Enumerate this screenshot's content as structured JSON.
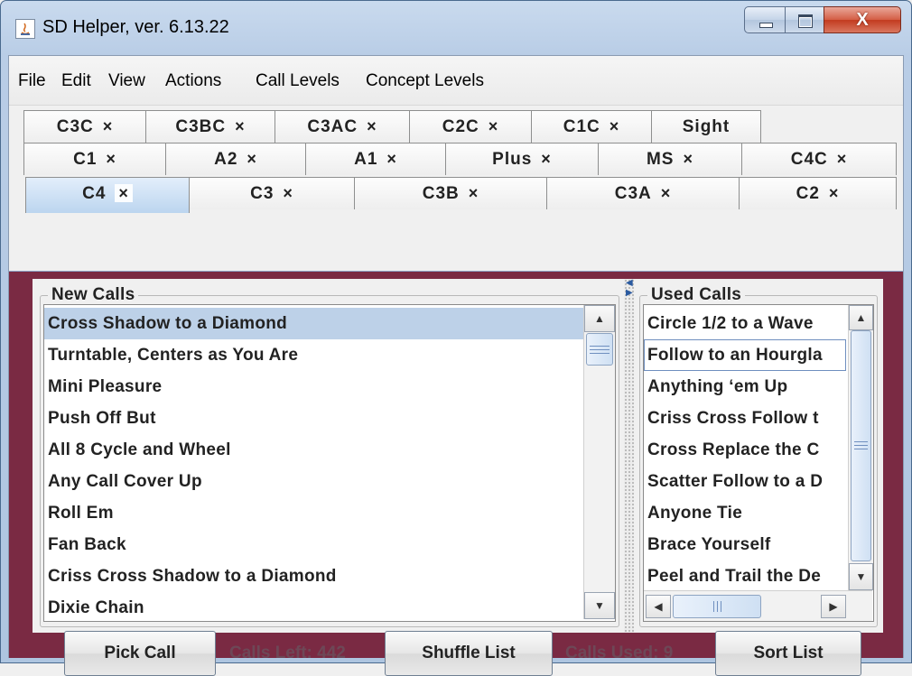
{
  "window": {
    "title": "SD Helper, ver. 6.13.22",
    "close_glyph": "X"
  },
  "menu": [
    "File",
    "Edit",
    "View",
    "Actions",
    "Call Levels",
    "Concept Levels"
  ],
  "tabs": {
    "row1": [
      {
        "label": "C3C",
        "close": "×"
      },
      {
        "label": "C3BC",
        "close": "×"
      },
      {
        "label": "C3AC",
        "close": "×"
      },
      {
        "label": "C2C",
        "close": "×"
      },
      {
        "label": "C1C",
        "close": "×"
      },
      {
        "label": "Sight",
        "close": ""
      }
    ],
    "row2": [
      {
        "label": "C1",
        "close": "×"
      },
      {
        "label": "A2",
        "close": "×"
      },
      {
        "label": "A1",
        "close": "×"
      },
      {
        "label": "Plus",
        "close": "×"
      },
      {
        "label": "MS",
        "close": "×"
      },
      {
        "label": "C4C",
        "close": "×"
      }
    ],
    "row3": [
      {
        "label": "C4",
        "close": "×"
      },
      {
        "label": "C3",
        "close": "×"
      },
      {
        "label": "C3B",
        "close": "×"
      },
      {
        "label": "C3A",
        "close": "×"
      },
      {
        "label": "C2",
        "close": "×"
      }
    ],
    "selected": "C4"
  },
  "new_calls": {
    "title": "New Calls",
    "items": [
      "Cross Shadow to a Diamond",
      "Turntable, Centers as You Are",
      "Mini Pleasure",
      "Push Off But",
      "All 8 Cycle and Wheel",
      "Any Call Cover Up",
      "Roll Em",
      "Fan Back",
      "Criss Cross Shadow to a Diamond",
      "Dixie Chain"
    ],
    "selected_index": 0
  },
  "used_calls": {
    "title": "Used Calls",
    "items": [
      "Circle 1/2 to a Wave",
      "Follow to an Hourgla",
      "Anything ‘em Up",
      "Criss Cross Follow t",
      "Cross Replace the C",
      "Scatter Follow to a D",
      "Anyone Tie",
      "Brace Yourself",
      "Peel and Trail the De"
    ],
    "focused_index": 1
  },
  "bottom": {
    "pick_call": "Pick Call",
    "calls_left": "Calls Left: 442",
    "shuffle_list": "Shuffle List",
    "calls_used": "Calls Used: 9",
    "sort_list": "Sort List"
  },
  "colors": {
    "panel_bg": "#7a2a43",
    "selected_row": "#bdd1e8",
    "status_text": "#6d4857"
  }
}
